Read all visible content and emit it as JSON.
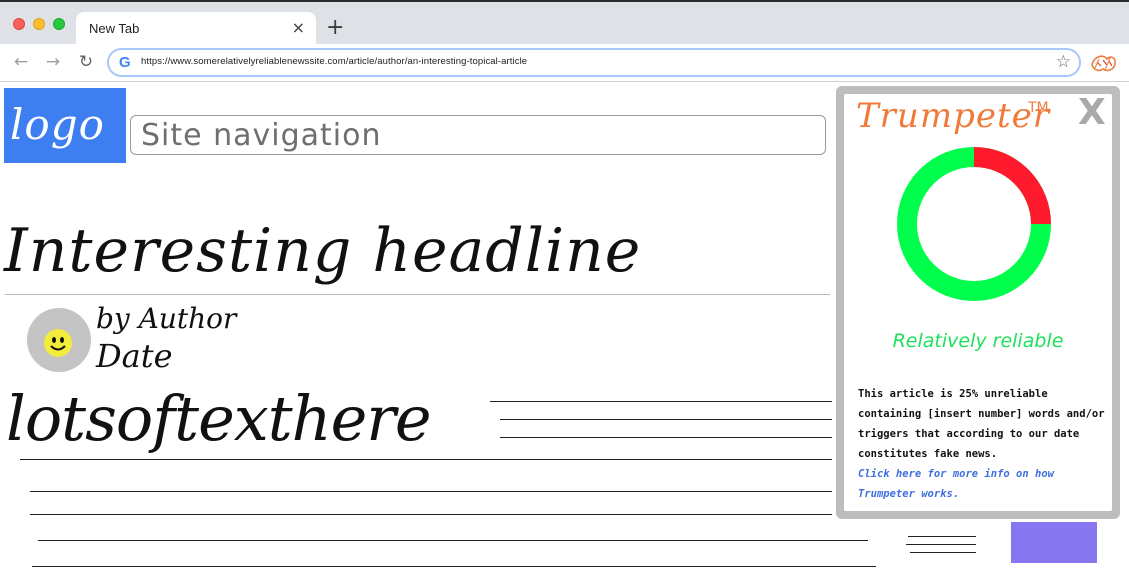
{
  "browser": {
    "tab_title": "New Tab",
    "tab_close": "×",
    "new_tab": "+",
    "url": "https://www.somerelativelyreliablenewssite.com/article/author/an-interesting-topical-article",
    "back_icon": "arrow-left-icon",
    "forward_icon": "arrow-right-icon",
    "reload_icon": "reload-icon",
    "star_icon": "star-icon",
    "extension_icon": "trumpeter-extension-icon"
  },
  "page": {
    "logo": "logo",
    "site_navigation": "Site navigation",
    "headline": "Interesting headline",
    "byline": "by Author",
    "date": "Date",
    "body_text": "lotsoftexthere"
  },
  "trumpeter": {
    "brand": "Trumpeter",
    "trademark": "TM",
    "close": "X",
    "verdict": "Relatively reliable",
    "description": "This article is 25% unreliable containing [insert number] words and/or triggers that according to our date constitutes fake news.",
    "more_info_link": "Click here for more info on how Trumpeter works.",
    "unreliable_fraction": 0.25,
    "colors": {
      "reliable": "#00ff4c",
      "unreliable": "#ff1a2e",
      "brand": "#f07a3a",
      "verdict": "#1ee05a",
      "link": "#3f6fe0"
    }
  },
  "colors": {
    "logo_bg": "#3d7ff1",
    "ad_box": "#8676f0"
  }
}
